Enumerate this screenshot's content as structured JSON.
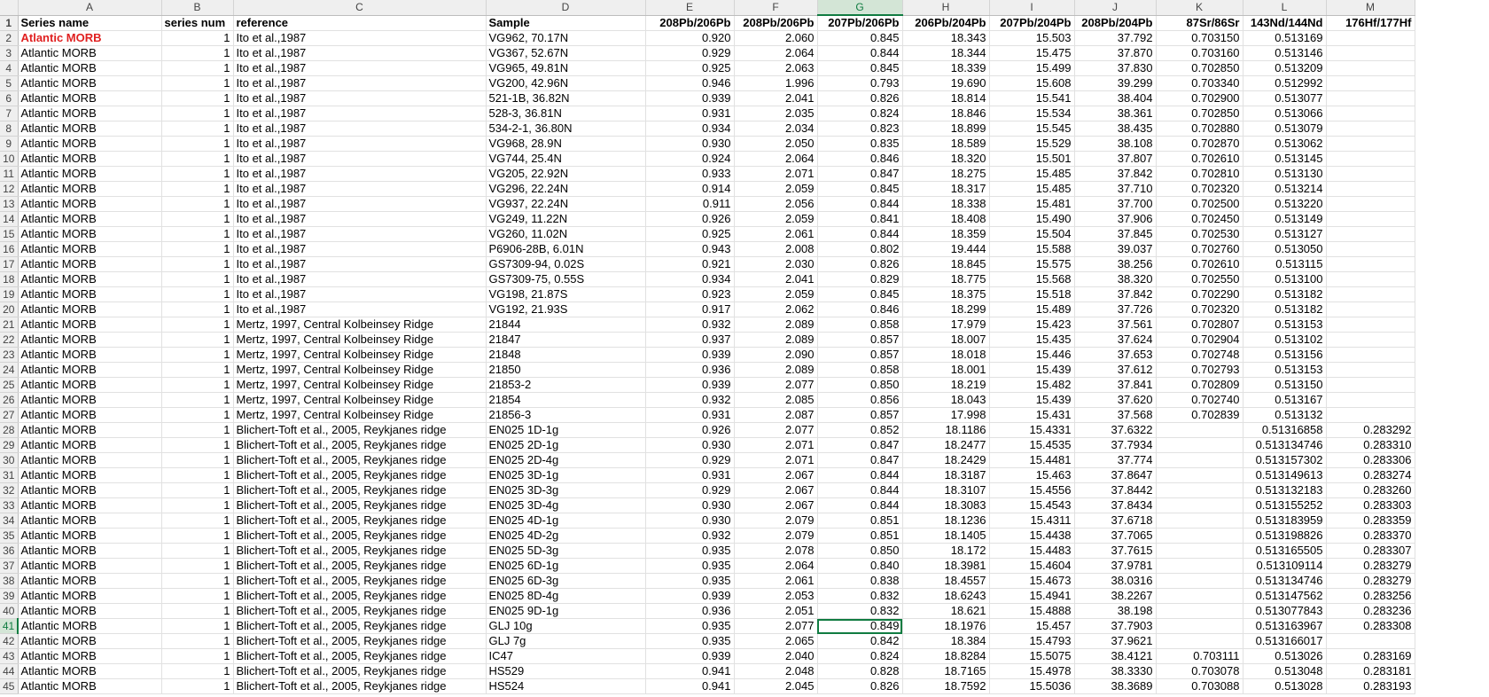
{
  "sheet": {
    "col_letters": [
      "A",
      "B",
      "C",
      "D",
      "E",
      "F",
      "G",
      "H",
      "I",
      "J",
      "K",
      "L",
      "M"
    ],
    "selected_col": "G",
    "selected_row": 41,
    "accent_color": "#107c41",
    "highlight_text_color": "#e02020",
    "header_row": [
      "Series name",
      "series num",
      "reference",
      "Sample",
      "208Pb/206Pb",
      "208Pb/206Pb",
      "207Pb/206Pb",
      "206Pb/204Pb",
      "207Pb/204Pb",
      "208Pb/204Pb",
      "87Sr/86Sr",
      "143Nd/144Nd",
      "176Hf/177Hf"
    ],
    "rows": [
      [
        "Atlantic MORB",
        "1",
        "Ito et al.,1987",
        "VG962, 70.17N",
        "0.920",
        "2.060",
        "0.845",
        "18.343",
        "15.503",
        "37.792",
        "0.703150",
        "0.513169",
        ""
      ],
      [
        "Atlantic MORB",
        "1",
        "Ito et al.,1987",
        "VG367, 52.67N",
        "0.929",
        "2.064",
        "0.844",
        "18.344",
        "15.475",
        "37.870",
        "0.703160",
        "0.513146",
        ""
      ],
      [
        "Atlantic MORB",
        "1",
        "Ito et al.,1987",
        "VG965, 49.81N",
        "0.925",
        "2.063",
        "0.845",
        "18.339",
        "15.499",
        "37.830",
        "0.702850",
        "0.513209",
        ""
      ],
      [
        "Atlantic MORB",
        "1",
        "Ito et al.,1987",
        "VG200, 42.96N",
        "0.946",
        "1.996",
        "0.793",
        "19.690",
        "15.608",
        "39.299",
        "0.703340",
        "0.512992",
        ""
      ],
      [
        "Atlantic MORB",
        "1",
        "Ito et al.,1987",
        "521-1B, 36.82N",
        "0.939",
        "2.041",
        "0.826",
        "18.814",
        "15.541",
        "38.404",
        "0.702900",
        "0.513077",
        ""
      ],
      [
        "Atlantic MORB",
        "1",
        "Ito et al.,1987",
        "528-3, 36.81N",
        "0.931",
        "2.035",
        "0.824",
        "18.846",
        "15.534",
        "38.361",
        "0.702850",
        "0.513066",
        ""
      ],
      [
        "Atlantic MORB",
        "1",
        "Ito et al.,1987",
        "534-2-1, 36.80N",
        "0.934",
        "2.034",
        "0.823",
        "18.899",
        "15.545",
        "38.435",
        "0.702880",
        "0.513079",
        ""
      ],
      [
        "Atlantic MORB",
        "1",
        "Ito et al.,1987",
        "VG968, 28.9N",
        "0.930",
        "2.050",
        "0.835",
        "18.589",
        "15.529",
        "38.108",
        "0.702870",
        "0.513062",
        ""
      ],
      [
        "Atlantic MORB",
        "1",
        "Ito et al.,1987",
        "VG744, 25.4N",
        "0.924",
        "2.064",
        "0.846",
        "18.320",
        "15.501",
        "37.807",
        "0.702610",
        "0.513145",
        ""
      ],
      [
        "Atlantic MORB",
        "1",
        "Ito et al.,1987",
        "VG205, 22.92N",
        "0.933",
        "2.071",
        "0.847",
        "18.275",
        "15.485",
        "37.842",
        "0.702810",
        "0.513130",
        ""
      ],
      [
        "Atlantic MORB",
        "1",
        "Ito et al.,1987",
        "VG296, 22.24N",
        "0.914",
        "2.059",
        "0.845",
        "18.317",
        "15.485",
        "37.710",
        "0.702320",
        "0.513214",
        ""
      ],
      [
        "Atlantic MORB",
        "1",
        "Ito et al.,1987",
        "VG937, 22.24N",
        "0.911",
        "2.056",
        "0.844",
        "18.338",
        "15.481",
        "37.700",
        "0.702500",
        "0.513220",
        ""
      ],
      [
        "Atlantic MORB",
        "1",
        "Ito et al.,1987",
        "VG249, 11.22N",
        "0.926",
        "2.059",
        "0.841",
        "18.408",
        "15.490",
        "37.906",
        "0.702450",
        "0.513149",
        ""
      ],
      [
        "Atlantic MORB",
        "1",
        "Ito et al.,1987",
        "VG260, 11.02N",
        "0.925",
        "2.061",
        "0.844",
        "18.359",
        "15.504",
        "37.845",
        "0.702530",
        "0.513127",
        ""
      ],
      [
        "Atlantic MORB",
        "1",
        "Ito et al.,1987",
        "P6906-28B, 6.01N",
        "0.943",
        "2.008",
        "0.802",
        "19.444",
        "15.588",
        "39.037",
        "0.702760",
        "0.513050",
        ""
      ],
      [
        "Atlantic MORB",
        "1",
        "Ito et al.,1987",
        "GS7309-94, 0.02S",
        "0.921",
        "2.030",
        "0.826",
        "18.845",
        "15.575",
        "38.256",
        "0.702610",
        "0.513115",
        ""
      ],
      [
        "Atlantic MORB",
        "1",
        "Ito et al.,1987",
        "GS7309-75, 0.55S",
        "0.934",
        "2.041",
        "0.829",
        "18.775",
        "15.568",
        "38.320",
        "0.702550",
        "0.513100",
        ""
      ],
      [
        "Atlantic MORB",
        "1",
        "Ito et al.,1987",
        "VG198, 21.87S",
        "0.923",
        "2.059",
        "0.845",
        "18.375",
        "15.518",
        "37.842",
        "0.702290",
        "0.513182",
        ""
      ],
      [
        "Atlantic MORB",
        "1",
        "Ito et al.,1987",
        "VG192, 21.93S",
        "0.917",
        "2.062",
        "0.846",
        "18.299",
        "15.489",
        "37.726",
        "0.702320",
        "0.513182",
        ""
      ],
      [
        "Atlantic MORB",
        "1",
        "Mertz, 1997, Central Kolbeinsey Ridge",
        "21844",
        "0.932",
        "2.089",
        "0.858",
        "17.979",
        "15.423",
        "37.561",
        "0.702807",
        "0.513153",
        ""
      ],
      [
        "Atlantic MORB",
        "1",
        "Mertz, 1997, Central Kolbeinsey Ridge",
        "21847",
        "0.937",
        "2.089",
        "0.857",
        "18.007",
        "15.435",
        "37.624",
        "0.702904",
        "0.513102",
        ""
      ],
      [
        "Atlantic MORB",
        "1",
        "Mertz, 1997, Central Kolbeinsey Ridge",
        "21848",
        "0.939",
        "2.090",
        "0.857",
        "18.018",
        "15.446",
        "37.653",
        "0.702748",
        "0.513156",
        ""
      ],
      [
        "Atlantic MORB",
        "1",
        "Mertz, 1997, Central Kolbeinsey Ridge",
        "21850",
        "0.936",
        "2.089",
        "0.858",
        "18.001",
        "15.439",
        "37.612",
        "0.702793",
        "0.513153",
        ""
      ],
      [
        "Atlantic MORB",
        "1",
        "Mertz, 1997, Central Kolbeinsey Ridge",
        "21853-2",
        "0.939",
        "2.077",
        "0.850",
        "18.219",
        "15.482",
        "37.841",
        "0.702809",
        "0.513150",
        ""
      ],
      [
        "Atlantic MORB",
        "1",
        "Mertz, 1997, Central Kolbeinsey Ridge",
        "21854",
        "0.932",
        "2.085",
        "0.856",
        "18.043",
        "15.439",
        "37.620",
        "0.702740",
        "0.513167",
        ""
      ],
      [
        "Atlantic MORB",
        "1",
        "Mertz, 1997, Central Kolbeinsey Ridge",
        "21856-3",
        "0.931",
        "2.087",
        "0.857",
        "17.998",
        "15.431",
        "37.568",
        "0.702839",
        "0.513132",
        ""
      ],
      [
        "Atlantic MORB",
        "1",
        "Blichert-Toft et al., 2005, Reykjanes ridge",
        "EN025 1D-1g",
        "0.926",
        "2.077",
        "0.852",
        "18.1186",
        "15.4331",
        "37.6322",
        "",
        "0.51316858",
        "0.283292"
      ],
      [
        "Atlantic MORB",
        "1",
        "Blichert-Toft et al., 2005, Reykjanes ridge",
        "EN025 2D-1g",
        "0.930",
        "2.071",
        "0.847",
        "18.2477",
        "15.4535",
        "37.7934",
        "",
        "0.513134746",
        "0.283310"
      ],
      [
        "Atlantic MORB",
        "1",
        "Blichert-Toft et al., 2005, Reykjanes ridge",
        "EN025 2D-4g",
        "0.929",
        "2.071",
        "0.847",
        "18.2429",
        "15.4481",
        "37.774",
        "",
        "0.513157302",
        "0.283306"
      ],
      [
        "Atlantic MORB",
        "1",
        "Blichert-Toft et al., 2005, Reykjanes ridge",
        "EN025 3D-1g",
        "0.931",
        "2.067",
        "0.844",
        "18.3187",
        "15.463",
        "37.8647",
        "",
        "0.513149613",
        "0.283274"
      ],
      [
        "Atlantic MORB",
        "1",
        "Blichert-Toft et al., 2005, Reykjanes ridge",
        "EN025 3D-3g",
        "0.929",
        "2.067",
        "0.844",
        "18.3107",
        "15.4556",
        "37.8442",
        "",
        "0.513132183",
        "0.283260"
      ],
      [
        "Atlantic MORB",
        "1",
        "Blichert-Toft et al., 2005, Reykjanes ridge",
        "EN025 3D-4g",
        "0.930",
        "2.067",
        "0.844",
        "18.3083",
        "15.4543",
        "37.8434",
        "",
        "0.513155252",
        "0.283303"
      ],
      [
        "Atlantic MORB",
        "1",
        "Blichert-Toft et al., 2005, Reykjanes ridge",
        "EN025 4D-1g",
        "0.930",
        "2.079",
        "0.851",
        "18.1236",
        "15.4311",
        "37.6718",
        "",
        "0.513183959",
        "0.283359"
      ],
      [
        "Atlantic MORB",
        "1",
        "Blichert-Toft et al., 2005, Reykjanes ridge",
        "EN025 4D-2g",
        "0.932",
        "2.079",
        "0.851",
        "18.1405",
        "15.4438",
        "37.7065",
        "",
        "0.513198826",
        "0.283370"
      ],
      [
        "Atlantic MORB",
        "1",
        "Blichert-Toft et al., 2005, Reykjanes ridge",
        "EN025 5D-3g",
        "0.935",
        "2.078",
        "0.850",
        "18.172",
        "15.4483",
        "37.7615",
        "",
        "0.513165505",
        "0.283307"
      ],
      [
        "Atlantic MORB",
        "1",
        "Blichert-Toft et al., 2005, Reykjanes ridge",
        "EN025 6D-1g",
        "0.935",
        "2.064",
        "0.840",
        "18.3981",
        "15.4604",
        "37.9781",
        "",
        "0.513109114",
        "0.283279"
      ],
      [
        "Atlantic MORB",
        "1",
        "Blichert-Toft et al., 2005, Reykjanes ridge",
        "EN025 6D-3g",
        "0.935",
        "2.061",
        "0.838",
        "18.4557",
        "15.4673",
        "38.0316",
        "",
        "0.513134746",
        "0.283279"
      ],
      [
        "Atlantic MORB",
        "1",
        "Blichert-Toft et al., 2005, Reykjanes ridge",
        "EN025 8D-4g",
        "0.939",
        "2.053",
        "0.832",
        "18.6243",
        "15.4941",
        "38.2267",
        "",
        "0.513147562",
        "0.283256"
      ],
      [
        "Atlantic MORB",
        "1",
        "Blichert-Toft et al., 2005, Reykjanes ridge",
        "EN025 9D-1g",
        "0.936",
        "2.051",
        "0.832",
        "18.621",
        "15.4888",
        "38.198",
        "",
        "0.513077843",
        "0.283236"
      ],
      [
        "Atlantic MORB",
        "1",
        "Blichert-Toft et al., 2005, Reykjanes ridge",
        "GLJ 10g",
        "0.935",
        "2.077",
        "0.849",
        "18.1976",
        "15.457",
        "37.7903",
        "",
        "0.513163967",
        "0.283308"
      ],
      [
        "Atlantic MORB",
        "1",
        "Blichert-Toft et al., 2005, Reykjanes ridge",
        "GLJ 7g",
        "0.935",
        "2.065",
        "0.842",
        "18.384",
        "15.4793",
        "37.9621",
        "",
        "0.513166017",
        ""
      ],
      [
        "Atlantic MORB",
        "1",
        "Blichert-Toft et al., 2005, Reykjanes ridge",
        "IC47",
        "0.939",
        "2.040",
        "0.824",
        "18.8284",
        "15.5075",
        "38.4121",
        "0.703111",
        "0.513026",
        "0.283169"
      ],
      [
        "Atlantic MORB",
        "1",
        "Blichert-Toft et al., 2005, Reykjanes ridge",
        "HS529",
        "0.941",
        "2.048",
        "0.828",
        "18.7165",
        "15.4978",
        "38.3330",
        "0.703078",
        "0.513048",
        "0.283181"
      ],
      [
        "Atlantic MORB",
        "1",
        "Blichert-Toft et al., 2005, Reykjanes ridge",
        "HS524",
        "0.941",
        "2.045",
        "0.826",
        "18.7592",
        "15.5036",
        "38.3689",
        "0.703088",
        "0.513028",
        "0.283193"
      ]
    ]
  }
}
